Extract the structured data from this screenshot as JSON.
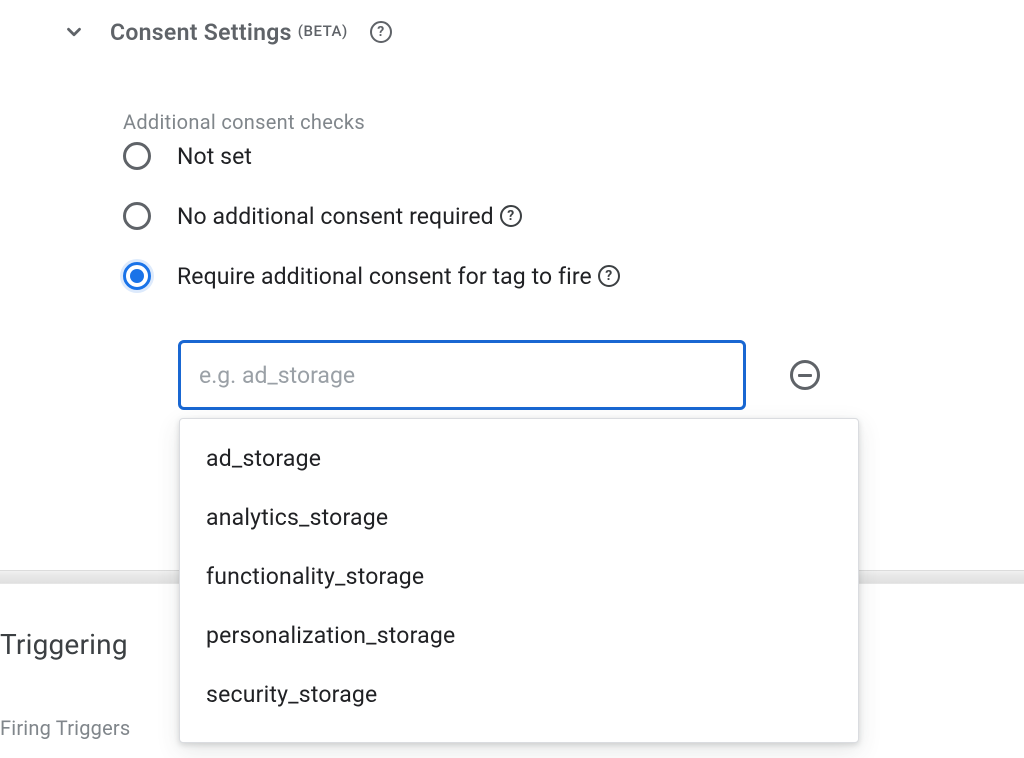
{
  "section": {
    "title": "Consent Settings",
    "beta": "(BETA)"
  },
  "consent": {
    "label": "Additional consent checks",
    "options": {
      "not_set": "Not set",
      "no_additional": "No additional consent required",
      "require_additional": "Require additional consent for tag to fire"
    },
    "selected": "require_additional",
    "input": {
      "value": "",
      "placeholder": "e.g. ad_storage"
    },
    "suggestions": [
      "ad_storage",
      "analytics_storage",
      "functionality_storage",
      "personalization_storage",
      "security_storage"
    ]
  },
  "next_section": {
    "title": "Triggering",
    "subtitle": "Firing Triggers"
  }
}
